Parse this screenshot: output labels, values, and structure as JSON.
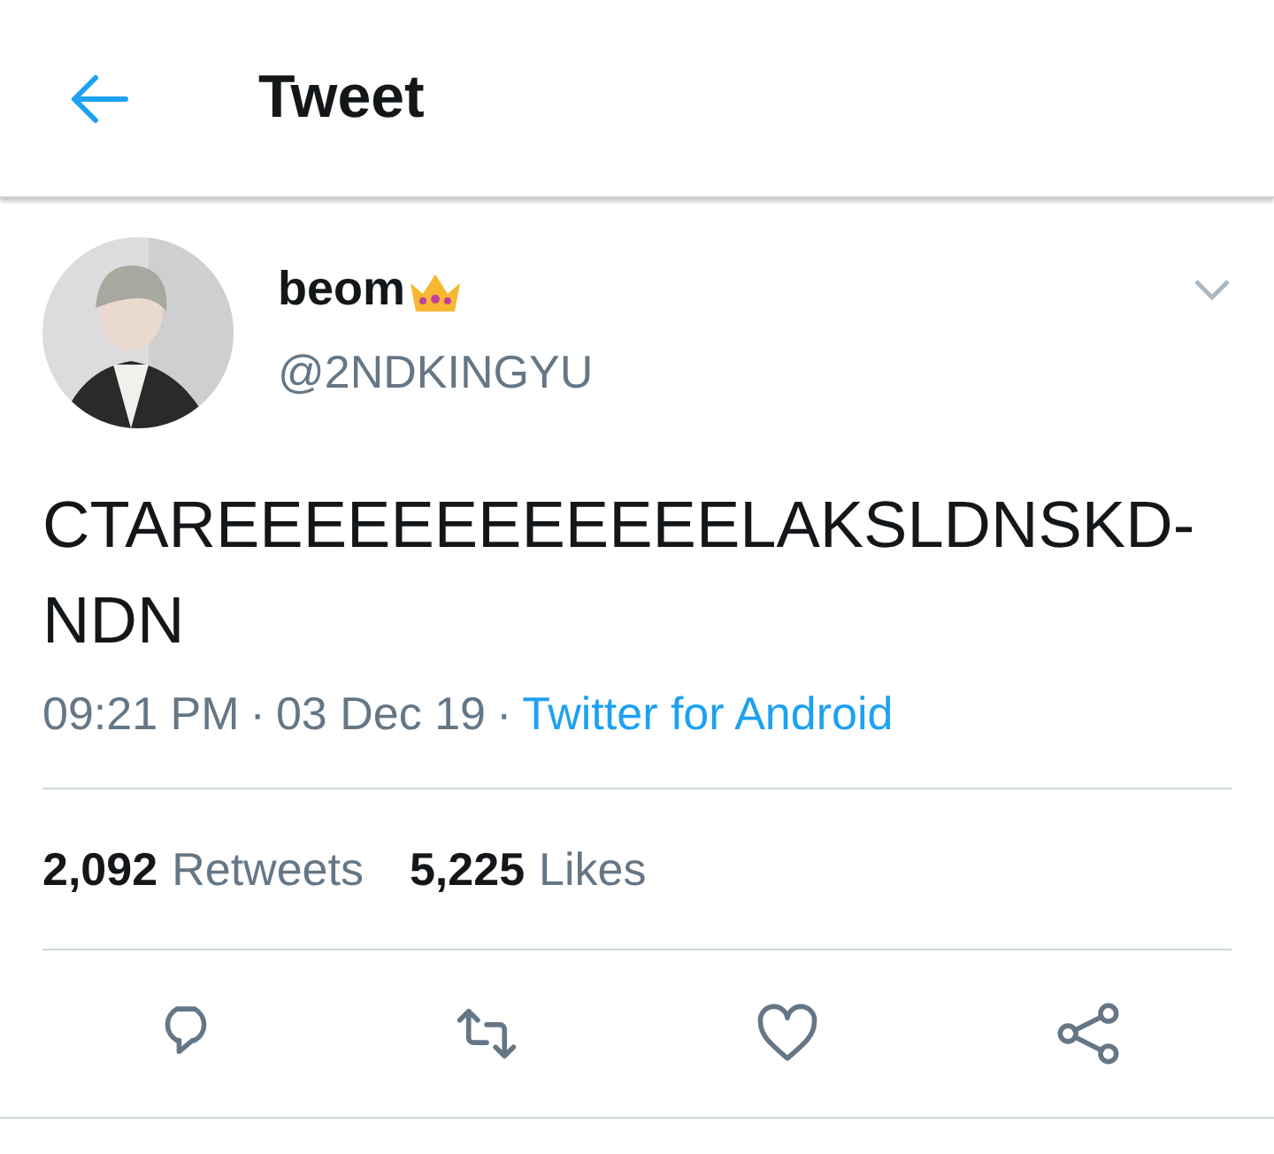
{
  "header": {
    "title": "Tweet"
  },
  "tweet": {
    "name": "beom",
    "handle": "@2NDKINGYU",
    "text": "CTAREEEEEEEEEEEELAKSLDNSKD-NDN",
    "time": "09:21 PM",
    "separator": "·",
    "date": "03 Dec 19",
    "source": "Twitter for Android"
  },
  "stats": [
    {
      "count": "2,092",
      "label": "Retweets"
    },
    {
      "count": "5,225",
      "label": "Likes"
    }
  ],
  "actions": [
    {
      "kind": "reply"
    },
    {
      "kind": "retweet"
    },
    {
      "kind": "like"
    },
    {
      "kind": "share"
    }
  ]
}
